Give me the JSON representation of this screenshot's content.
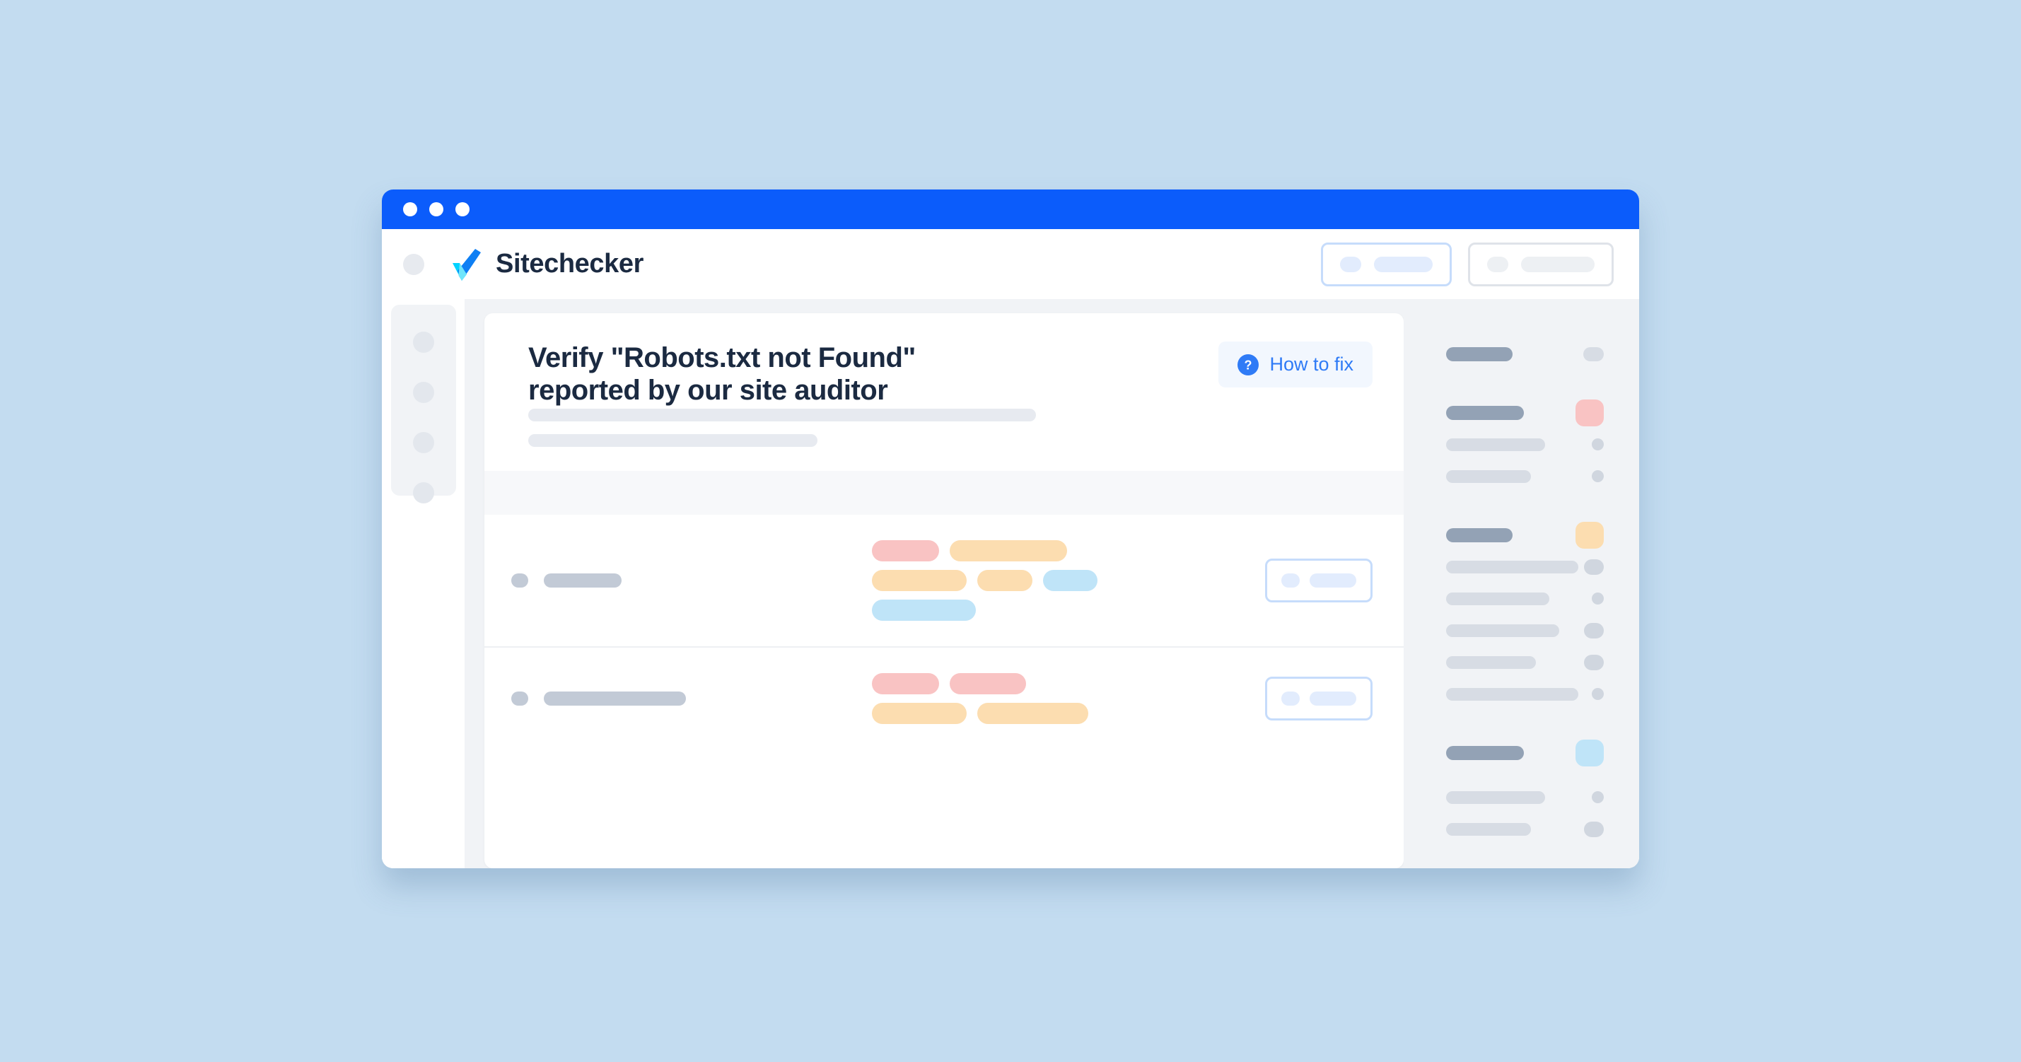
{
  "page": {
    "background_color": "#c3dcf0"
  },
  "window": {
    "titlebar_color": "#0b5cfb",
    "traffic_lights": [
      "close-dot",
      "minimize-dot",
      "maximize-dot"
    ]
  },
  "header": {
    "menu_icon": "hamburger-circle-icon",
    "brand_name": "Sitechecker",
    "logo_icon": "sitechecker-check-logo",
    "logo_colors": {
      "cyan": "#00d2ff",
      "blue": "#0e7ff4",
      "overlap": "#7ee8fb"
    },
    "actions": [
      {
        "name": "primary-skeleton-button",
        "style": "primary",
        "border_color": "#c6dcfb",
        "fill_color": "#e2ecfd"
      },
      {
        "name": "secondary-skeleton-button",
        "style": "secondary",
        "border_color": "#dfe3e9",
        "fill_color": "#edf0f3"
      }
    ]
  },
  "left_rail": {
    "items": [
      "rail-item-1",
      "rail-item-2",
      "rail-item-3",
      "rail-item-4"
    ]
  },
  "main": {
    "title": "Verify \"Robots.txt not Found\"\nreported by our site auditor",
    "title_color": "#1b2a41",
    "subtitle_skeletons": [
      718,
      409
    ],
    "how_to_fix": {
      "label": "How to fix",
      "icon": "question-mark-circle-icon",
      "text_color": "#2f7bf6",
      "background_color": "#f2f7fe"
    },
    "rows": [
      {
        "name": "result-row-1",
        "label_width": 110,
        "tag_lines": [
          [
            {
              "color": "pink",
              "width": 95
            },
            {
              "color": "orange",
              "width": 166
            }
          ],
          [
            {
              "color": "orange",
              "width": 134
            },
            {
              "color": "orange",
              "width": 78
            },
            {
              "color": "blue",
              "width": 77
            }
          ],
          [
            {
              "color": "blue",
              "width": 147
            }
          ]
        ],
        "action": {
          "name": "row-action-button",
          "border_color": "#c6dcfb",
          "fill_color": "#e2ecfd"
        }
      },
      {
        "name": "result-row-2",
        "label_width": 201,
        "tag_lines": [
          [
            {
              "color": "pink",
              "width": 95
            },
            {
              "color": "pink",
              "width": 108
            }
          ],
          [
            {
              "color": "orange",
              "width": 134
            },
            {
              "color": "orange",
              "width": 157
            }
          ]
        ],
        "action": {
          "name": "row-action-button",
          "border_color": "#c6dcfb",
          "fill_color": "#e2ecfd"
        }
      }
    ]
  },
  "right_panel": {
    "groups": [
      {
        "name": "panel-group-1",
        "rows": [
          {
            "bar": "head",
            "width": 94,
            "badge": "gray"
          }
        ]
      },
      {
        "name": "panel-group-2",
        "rows": [
          {
            "bar": "head",
            "width": 110,
            "badge": "pink"
          },
          {
            "bar": "sub",
            "width": 140,
            "badge": "dot"
          },
          {
            "bar": "sub",
            "width": 120,
            "badge": "dot"
          }
        ]
      },
      {
        "name": "panel-group-3",
        "rows": [
          {
            "bar": "head",
            "width": 94,
            "badge": "orange"
          },
          {
            "bar": "sub",
            "width": 187,
            "badge": "dot-lg"
          },
          {
            "bar": "sub",
            "width": 146,
            "badge": "dot"
          },
          {
            "bar": "sub",
            "width": 160,
            "badge": "dot-lg"
          },
          {
            "bar": "sub",
            "width": 127,
            "badge": "dot-lg"
          },
          {
            "bar": "sub",
            "width": 187,
            "badge": "dot"
          }
        ]
      },
      {
        "name": "panel-group-4",
        "rows": [
          {
            "bar": "head",
            "width": 110,
            "badge": "blue"
          },
          {
            "bar": "sub",
            "width": 140,
            "badge": "dot"
          },
          {
            "bar": "sub",
            "width": 120,
            "badge": "dot-lg"
          }
        ]
      }
    ]
  }
}
